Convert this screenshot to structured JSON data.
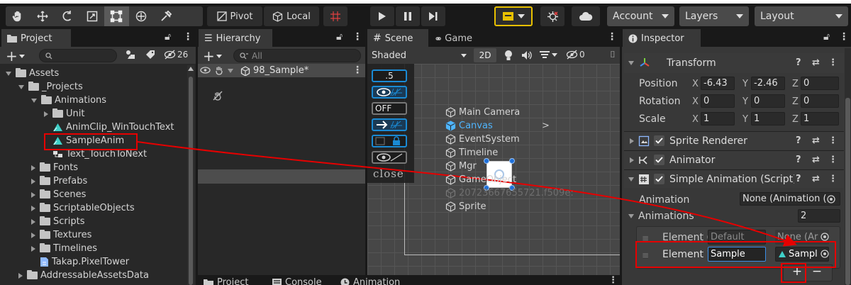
{
  "toolbar": {
    "tools": [
      "hand-tool",
      "move-tool",
      "rotate-tool",
      "scale-tool",
      "rect-tool",
      "transform-tool",
      "custom-tool"
    ],
    "pivot_label": "Pivot",
    "local_label": "Local",
    "account_label": "Account",
    "layers_label": "Layers",
    "layout_label": "Layout"
  },
  "project": {
    "tab_label": "Project",
    "count_label": "26",
    "tree": [
      {
        "label": "Assets",
        "kind": "folder-open"
      },
      {
        "label": "_Projects",
        "kind": "folder-open"
      },
      {
        "label": "Animations",
        "kind": "folder-open"
      },
      {
        "label": "Unit",
        "kind": "folder"
      },
      {
        "label": "AnimClip_WinTouchText",
        "kind": "anim"
      },
      {
        "label": "SampleAnim",
        "kind": "anim"
      },
      {
        "label": "Text_TouchToNext",
        "kind": "controller"
      },
      {
        "label": "Fonts",
        "kind": "folder"
      },
      {
        "label": "Prefabs",
        "kind": "folder"
      },
      {
        "label": "Scenes",
        "kind": "folder"
      },
      {
        "label": "ScriptableObjects",
        "kind": "folder"
      },
      {
        "label": "Scripts",
        "kind": "folder"
      },
      {
        "label": "Textures",
        "kind": "folder"
      },
      {
        "label": "Timelines",
        "kind": "folder"
      },
      {
        "label": "Takap.PixelTower",
        "kind": "asmdef"
      },
      {
        "label": "AddressableAssetsData",
        "kind": "folder"
      }
    ]
  },
  "hierarchy": {
    "tab_label": "Hierarchy",
    "search_placeholder": "All",
    "scene_name": "98_Sample*",
    "items": [
      "Main Camera",
      "Canvas",
      "EventSystem",
      "Timeline",
      "Mgr",
      "GameObject",
      "20723667655721.f509e:",
      "Sprite"
    ]
  },
  "scene": {
    "tab_scene": "Scene",
    "tab_game": "Game",
    "shading": "Shaded",
    "mode_2d": "2D",
    "gizmo_count": "0",
    "overlay": [
      ".5",
      "",
      "OFF",
      "",
      "",
      "",
      "close"
    ]
  },
  "inspector": {
    "tab_label": "Inspector",
    "transform": {
      "title": "Transform",
      "rows": [
        {
          "label": "Position",
          "x": "-6.43",
          "y": "-2.46",
          "z": "0"
        },
        {
          "label": "Rotation",
          "x": "0",
          "y": "0",
          "z": "0"
        },
        {
          "label": "Scale",
          "x": "1",
          "y": "1",
          "z": "1"
        }
      ]
    },
    "components": [
      "Sprite Renderer",
      "Animator",
      "Simple Animation (Script)"
    ],
    "animation_label": "Animation",
    "animation_value": "None (Animation (",
    "animations_label": "Animations",
    "animations_count": "2",
    "elements": [
      {
        "label": "Element (",
        "name": "Default",
        "clip": "None (Ar"
      },
      {
        "label": "Element 1",
        "name": "Sample",
        "clip": "Sampl"
      }
    ],
    "plus": "+",
    "minus": "−"
  },
  "bottom_tabs": [
    "Project",
    "Console",
    "Animation"
  ],
  "colors": {
    "accent": "#e60000",
    "selection": "#2c5d87",
    "highlight_blue": "#1a8ad4"
  }
}
